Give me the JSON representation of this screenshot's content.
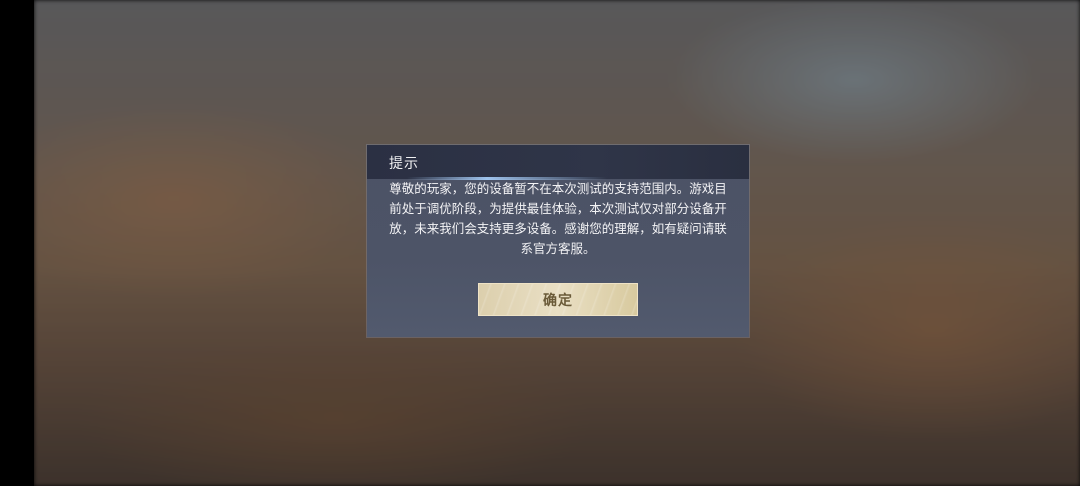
{
  "dialog": {
    "title": "提示",
    "message": "尊敬的玩家，您的设备暂不在本次测试的支持范围内。游戏目前处于调优阶段，为提供最佳体验，本次测试仅对部分设备开放，未来我们会支持更多设备。感谢您的理解，如有疑问请联系官方客服。",
    "confirm_label": "确定"
  },
  "colors": {
    "dialog_bg": "#4d5467",
    "header_bg": "#2c3145",
    "button_gold": "#e4d8b8",
    "button_text": "#6a5a38"
  }
}
